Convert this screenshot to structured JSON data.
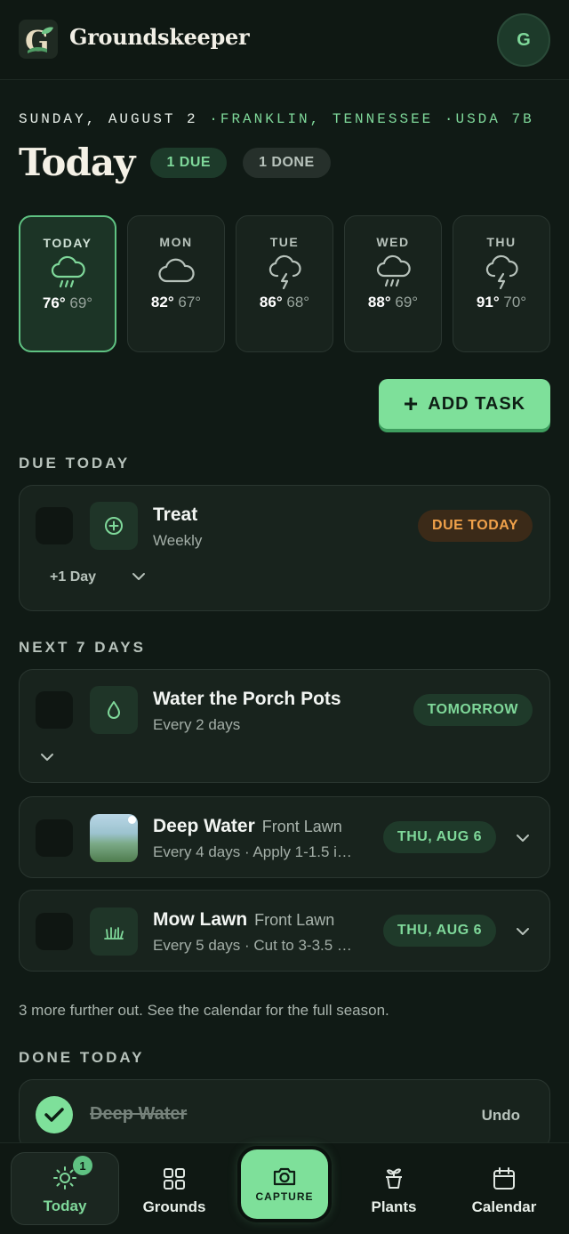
{
  "app": {
    "brand": "Groundskeeper",
    "logo_letter": "G",
    "avatar_initial": "G"
  },
  "meta": {
    "date": "SUNDAY, AUGUST 2",
    "location": "·FRANKLIN, TENNESSEE",
    "zone": "·USDA 7B"
  },
  "page": {
    "title": "Today",
    "due_pill": "1 DUE",
    "done_pill": "1 DONE"
  },
  "forecast": [
    {
      "name": "TODAY",
      "hi": "76°",
      "lo": "69°",
      "icon": "rain-cloud-icon"
    },
    {
      "name": "MON",
      "hi": "82°",
      "lo": "67°",
      "icon": "cloud-icon"
    },
    {
      "name": "TUE",
      "hi": "86°",
      "lo": "68°",
      "icon": "thunder-cloud-icon"
    },
    {
      "name": "WED",
      "hi": "88°",
      "lo": "69°",
      "icon": "rain-cloud-icon"
    },
    {
      "name": "THU",
      "hi": "91°",
      "lo": "70°",
      "icon": "thunder-cloud-icon"
    }
  ],
  "actions": {
    "add_task": "ADD TASK"
  },
  "sections": {
    "due_today": "DUE TODAY",
    "next_7_days": "NEXT 7 DAYS",
    "done_today": "DONE TODAY"
  },
  "due_tasks": [
    {
      "name": "Treat",
      "sub": "Weekly",
      "badge": "DUE TODAY",
      "snooze": "+1 Day",
      "icon": "plus-circle-icon"
    }
  ],
  "upcoming_tasks": [
    {
      "name": "Water the Porch Pots",
      "location": "",
      "sub": "Every 2 days",
      "badge": "TOMORROW",
      "icon": "water-drop-icon"
    },
    {
      "name": "Deep Water",
      "location": "Front Lawn",
      "sub": "Every 4 days · Apply 1-1.5 i…",
      "badge": "THU, AUG 6",
      "icon": "lawn-photo"
    },
    {
      "name": "Mow Lawn",
      "location": "Front Lawn",
      "sub": "Every 5 days · Cut to 3-3.5 …",
      "badge": "THU, AUG 6",
      "icon": "grass-icon"
    }
  ],
  "note": "3 more further out. See the calendar for the full season.",
  "done_tasks": [
    {
      "name": "Deep Water",
      "undo": "Undo"
    }
  ],
  "tabs": [
    {
      "label": "Today",
      "icon": "sun-icon",
      "badge": "1"
    },
    {
      "label": "Grounds",
      "icon": "grid-icon"
    },
    {
      "label": "CAPTURE",
      "icon": "camera-icon"
    },
    {
      "label": "Plants",
      "icon": "potted-plant-icon"
    },
    {
      "label": "Calendar",
      "icon": "calendar-icon"
    }
  ],
  "colors": {
    "accent": "#7ee09a",
    "background": "#101a15",
    "warning": "#f0a14a"
  }
}
